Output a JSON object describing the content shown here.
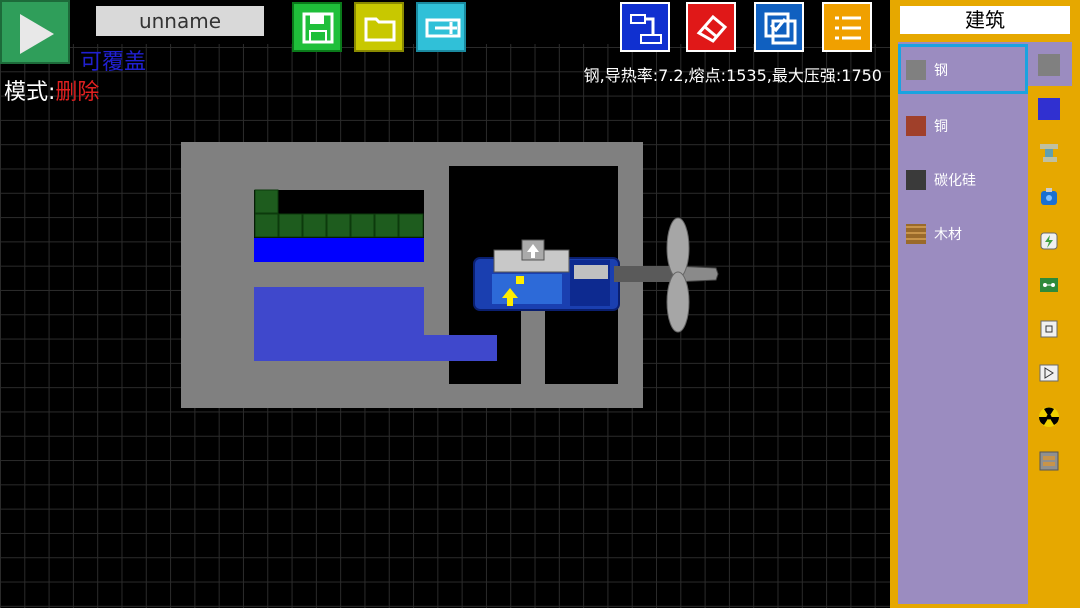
{
  "top": {
    "project_name": "unname",
    "overwrite_label": "可覆盖"
  },
  "mode": {
    "label": "模式:",
    "value": "删除"
  },
  "info_text": "钢,导热率:7.2,熔点:1535,最大压强:1750",
  "panel": {
    "title": "建筑",
    "materials": [
      {
        "label": "钢",
        "color": "#808080"
      },
      {
        "label": "铜",
        "color": "#a0402a"
      },
      {
        "label": "碳化硅",
        "color": "#3a3a3a"
      },
      {
        "label": "木材",
        "color": "#9a6a2a"
      }
    ]
  },
  "colors": {
    "panel_bg": "#e6a800",
    "play_green": "#2f9e5a",
    "structure_gray": "#808080",
    "water_blue": "#0000ff"
  }
}
